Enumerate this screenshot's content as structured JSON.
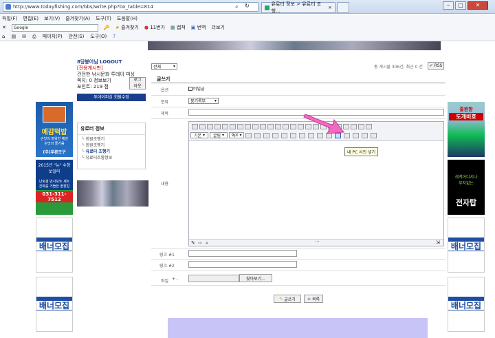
{
  "browser": {
    "url": "http://www.todayfishing.com/bbs/write.php?bo_table=814",
    "tab_title": "유료터 정보 > 유료터 조행...",
    "menu": [
      "파일(F)",
      "편집(E)",
      "보기(V)",
      "즐겨찾기(A)",
      "도구(T)",
      "도움말(H)"
    ],
    "search_engine": "Google",
    "fav": {
      "favorites": "즐겨찾기",
      "count": "11번가",
      "capture": "캡쳐",
      "translate": "번역",
      "more": "더보기"
    },
    "cmd": {
      "page": "페이지(P)",
      "safety": "안전(S)",
      "tools": "도구(O)"
    }
  },
  "login": {
    "user": "8당붕어님 LOGOUT",
    "board": "[전용게시판]",
    "level": "건전한 낚시문화 투데이 피싱",
    "points_label": "쪽지: 0  정보보기",
    "points": "포인트: 219 점",
    "logout_btn": "로그\n아웃",
    "edit_btn": "투데이피싱 회원수정"
  },
  "sidebar": {
    "title": "유료터 정보",
    "items": [
      "회원조행기",
      "회원조행기",
      "유료터 조행기",
      "유료터조황정보"
    ]
  },
  "board": {
    "filter": "전체",
    "stats": "총 게시물 306건, 최근 0 건",
    "rss": "RSS",
    "heading": "글쓰기",
    "option_label": "옵션",
    "secret": "비밀글",
    "category_label": "분류",
    "category": "붕기록부",
    "subject_label": "제목",
    "content_label": "내용",
    "link1_label": "링크 #1",
    "link2_label": "링크 #2",
    "file_label": "파일",
    "file_plus": "+ -",
    "browse": "찾아보기...",
    "font": "기본",
    "font2": "굴림",
    "size": "9pt",
    "tooltip": "내 PC 사진 넣기",
    "submit": "글쓰기",
    "list": "목록"
  },
  "banners": {
    "left1_title": "예감떡밥",
    "left1_sub": "손맛의 파워한 예감\n손맛의 즐거움",
    "left1_brand": "(주)푸른조구",
    "left2_title": "2015년 \"뉴\" 수창보일러",
    "left2_sub": "난로겸 반사보트 세트\n진화를 거듭한 끝장판",
    "left2_phone": "031-311-7512",
    "right1_title": "홍원항",
    "right1_sub": "도개비호",
    "right2_sub": "세계어디서나\n부자없는",
    "right2_title": "전자탑",
    "recruit": "배너모집"
  }
}
